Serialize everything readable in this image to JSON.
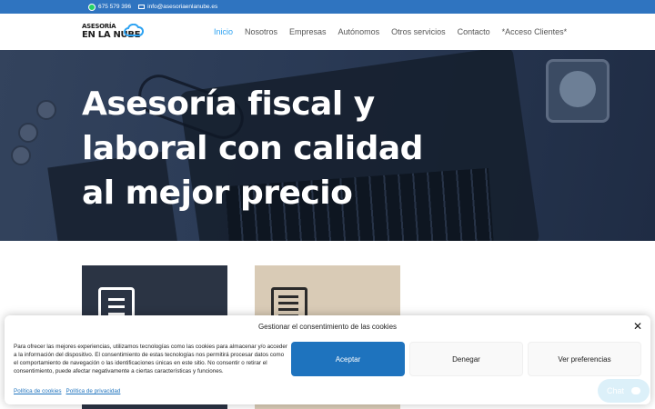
{
  "topbar": {
    "phone": "675 579 396",
    "email": "info@asesoriaenlanube.es"
  },
  "header": {
    "logo_line1": "ASESORÍA",
    "logo_line2": "EN LA NUBE",
    "nav": [
      {
        "label": "Inicio",
        "active": true
      },
      {
        "label": "Nosotros",
        "active": false
      },
      {
        "label": "Empresas",
        "active": false
      },
      {
        "label": "Autónomos",
        "active": false
      },
      {
        "label": "Otros servicios",
        "active": false
      },
      {
        "label": "Contacto",
        "active": false
      },
      {
        "label": "*Acceso Clientes*",
        "active": false
      }
    ]
  },
  "hero": {
    "title_line1": "Asesoría fiscal y",
    "title_line2": "laboral con calidad",
    "title_line3": "al mejor precio"
  },
  "cookie": {
    "title": "Gestionar el consentimiento de las cookies",
    "text": "Para ofrecer las mejores experiencias, utilizamos tecnologías como las cookies para almacenar y/o acceder a la información del dispositivo. El consentimiento de estas tecnologías nos permitirá procesar datos como el comportamiento de navegación o las identificaciones únicas en este sitio. No consentir o retirar el consentimiento, puede afectar negativamente a ciertas características y funciones.",
    "accept": "Aceptar",
    "deny": "Denegar",
    "prefs": "Ver preferencias",
    "link_cookies": "Política de cookies",
    "link_privacy": "Política de privacidad"
  },
  "chat": {
    "label": "Chat"
  },
  "colors": {
    "topbar": "#2f74c0",
    "nav_active": "#2ea3f2",
    "accept_button": "#1e73be",
    "card_dark": "#2b3444",
    "card_beige": "#d9cbb6"
  },
  "icons": [
    "whatsapp-icon",
    "mail-icon",
    "cloud-logo-icon",
    "document-icon",
    "newspaper-icon",
    "close-icon",
    "chat-bubble-icon"
  ]
}
